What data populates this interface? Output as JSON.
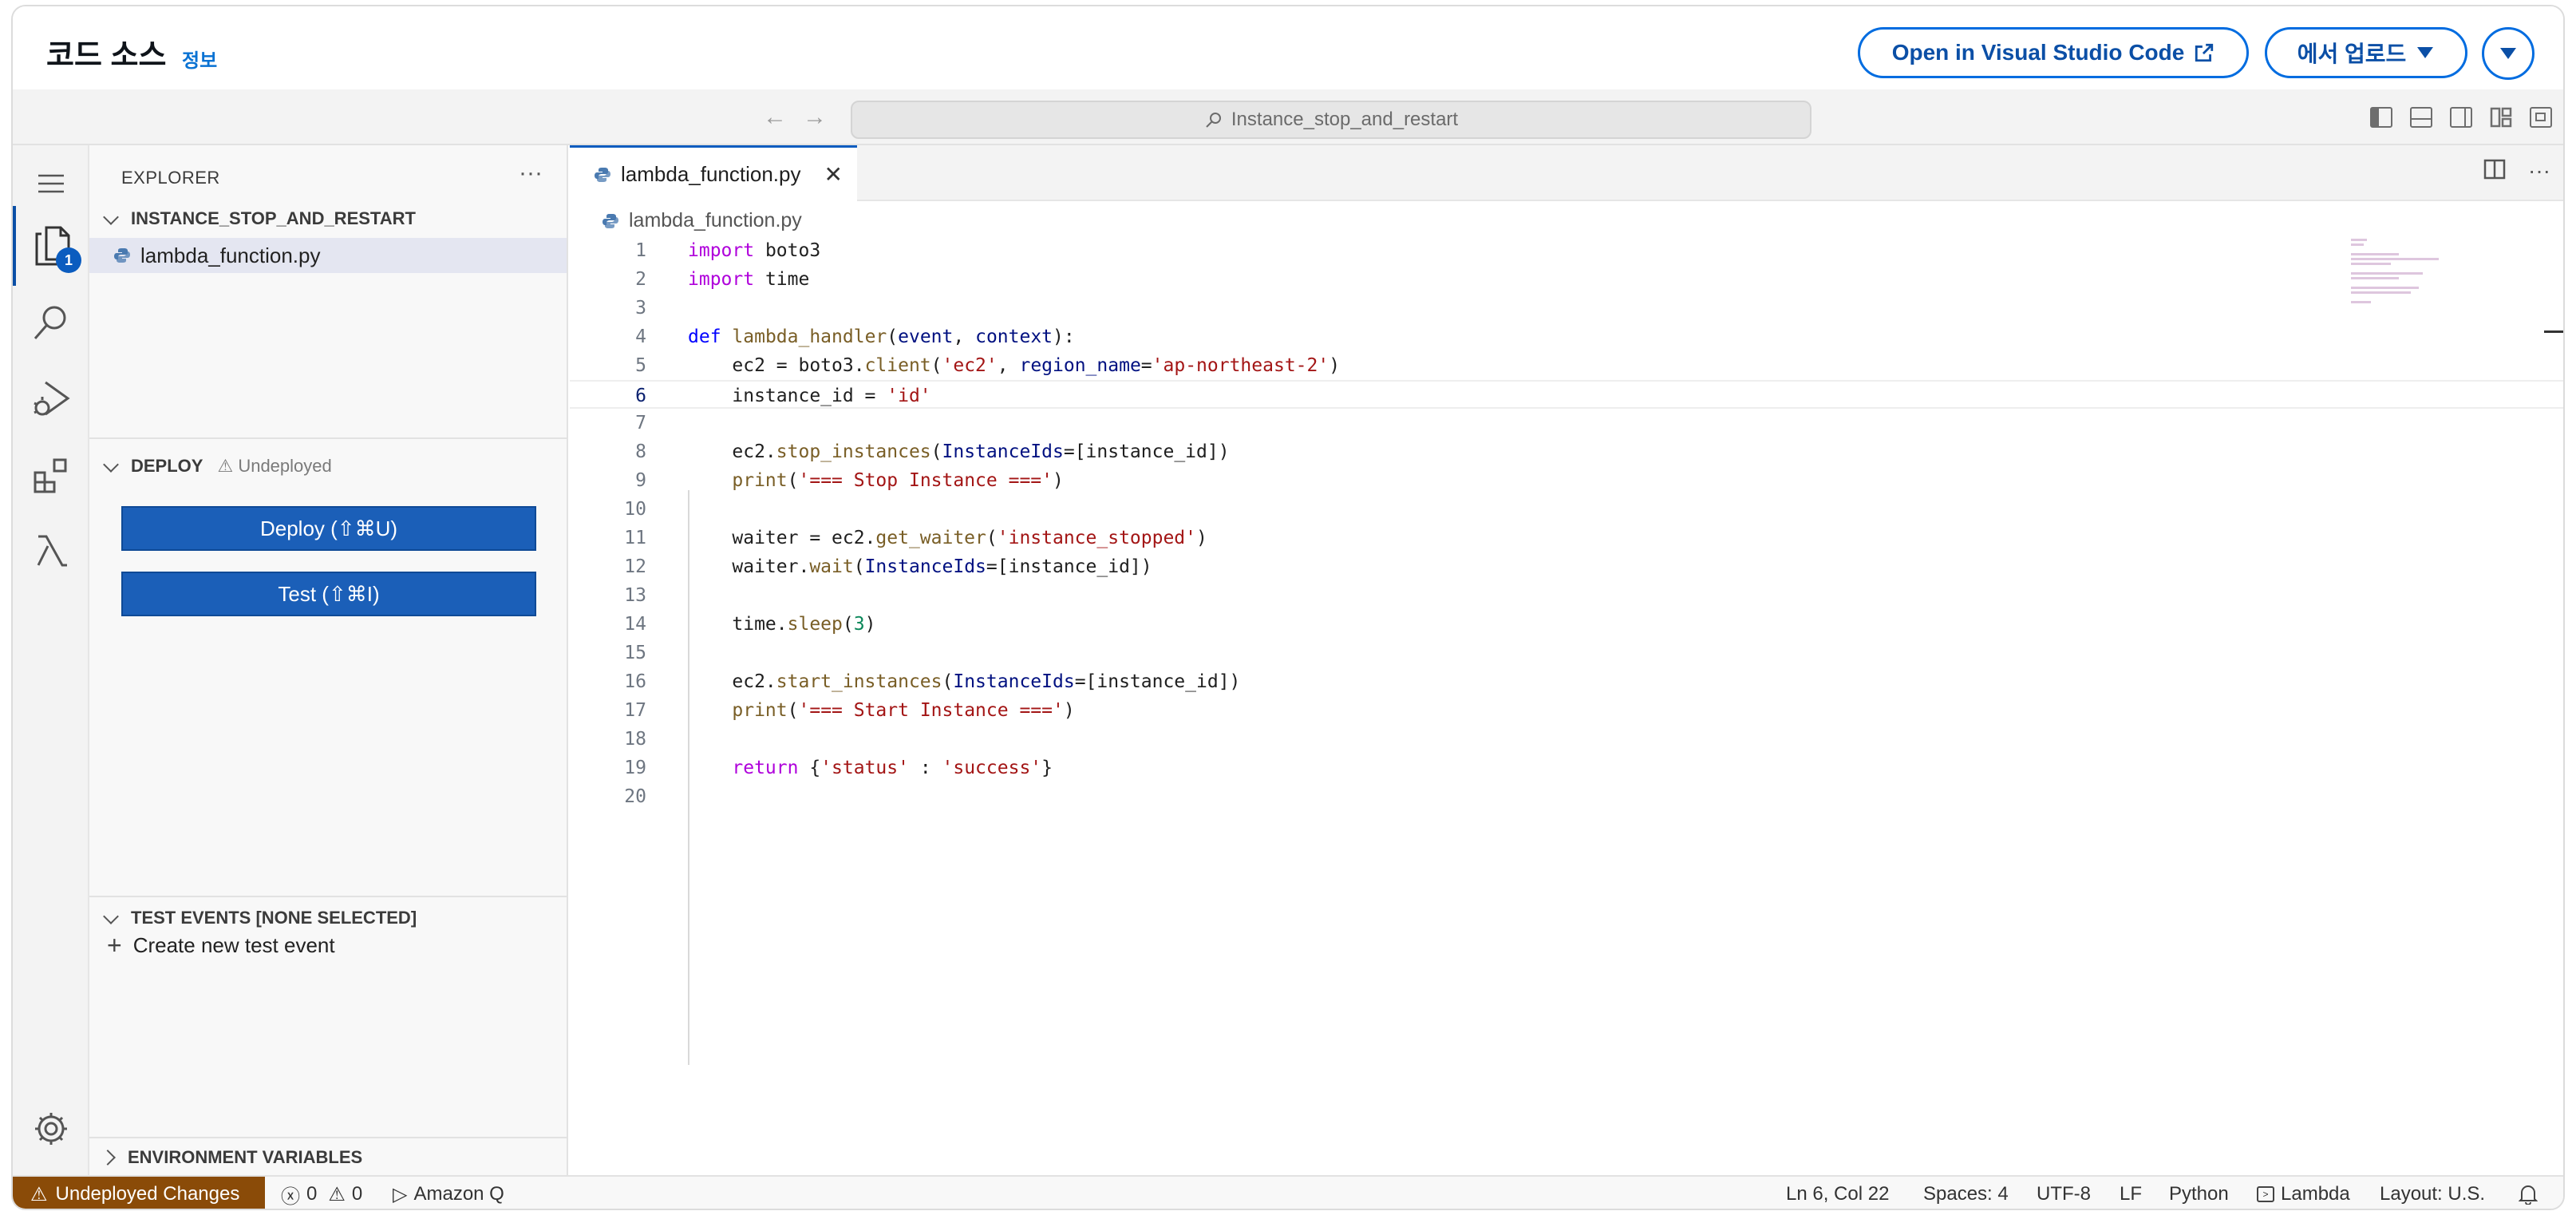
{
  "header": {
    "title": "코드 소스",
    "info_link": "정보",
    "open_vscode_label": "Open in Visual Studio Code",
    "upload_label": "에서 업로드"
  },
  "titlebar": {
    "search_text": "Instance_stop_and_restart"
  },
  "activity_bar": {
    "explorer_badge": "1"
  },
  "sidebar": {
    "title": "EXPLORER",
    "folder": "INSTANCE_STOP_AND_RESTART",
    "file": "lambda_function.py",
    "deploy_title": "DEPLOY",
    "deploy_state": "Undeployed",
    "deploy_button": "Deploy (⇧⌘U)",
    "test_button": "Test (⇧⌘I)",
    "test_events_title": "TEST EVENTS [NONE SELECTED]",
    "create_test_event": "Create new test event",
    "env_vars_title": "ENVIRONMENT VARIABLES"
  },
  "editor": {
    "tab_label": "lambda_function.py",
    "breadcrumb": "lambda_function.py",
    "current_line": 6,
    "lines": [
      "import boto3",
      "import time",
      "",
      "def lambda_handler(event, context):",
      "    ec2 = boto3.client('ec2', region_name='ap-northeast-2')",
      "    instance_id = 'id'",
      "",
      "    ec2.stop_instances(InstanceIds=[instance_id])",
      "    print('=== Stop Instance ===')",
      "",
      "    waiter = ec2.get_waiter('instance_stopped')",
      "    waiter.wait(InstanceIds=[instance_id])",
      "",
      "    time.sleep(3)",
      "",
      "    ec2.start_instances(InstanceIds=[instance_id])",
      "    print('=== Start Instance ===')",
      "",
      "    return {'status' : 'success'}",
      ""
    ]
  },
  "statusbar": {
    "warning": "Undeployed Changes",
    "errors": "0",
    "warnings": "0",
    "amazon_q": "Amazon Q",
    "position": "Ln 6, Col 22",
    "spaces": "Spaces: 4",
    "encoding": "UTF-8",
    "eol": "LF",
    "language": "Python",
    "lambda": "Lambda",
    "layout": "Layout: U.S."
  },
  "colors": {
    "accent": "#0b5cbf",
    "warning_bg": "#8a4b08",
    "keyword": "#af00db",
    "string": "#a31515"
  }
}
